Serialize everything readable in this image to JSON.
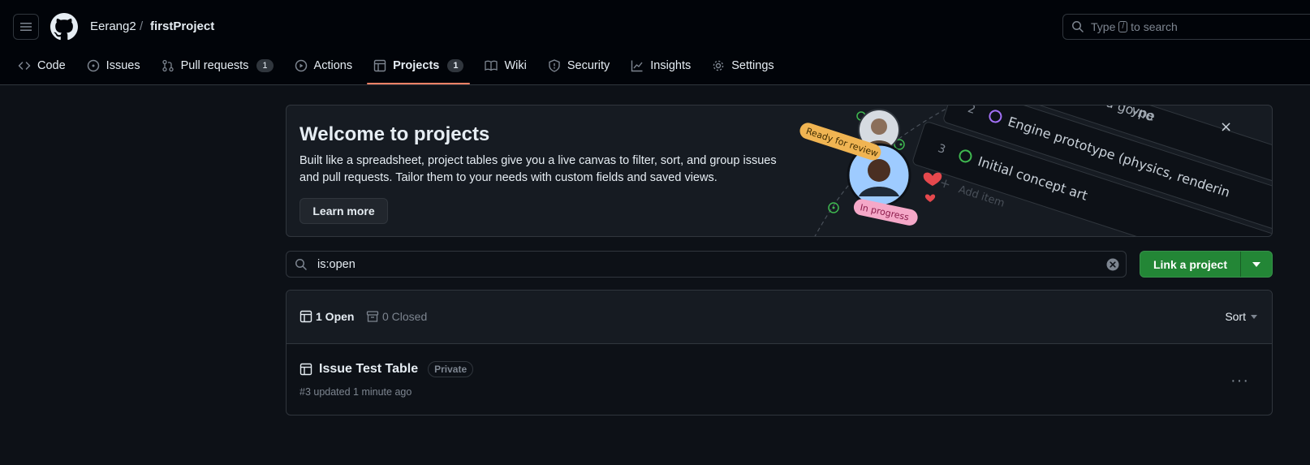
{
  "header": {
    "owner": "Eerang2",
    "separator": "/",
    "repo": "firstProject",
    "search": {
      "prefix": "Type",
      "key": "/",
      "suffix": "to search"
    }
  },
  "tabs": [
    {
      "label": "Code",
      "icon": "code-icon"
    },
    {
      "label": "Issues",
      "icon": "issue-icon"
    },
    {
      "label": "Pull requests",
      "icon": "pull-request-icon",
      "count": "1"
    },
    {
      "label": "Actions",
      "icon": "play-icon"
    },
    {
      "label": "Projects",
      "icon": "table-icon",
      "count": "1",
      "active": true
    },
    {
      "label": "Wiki",
      "icon": "book-icon"
    },
    {
      "label": "Security",
      "icon": "shield-icon"
    },
    {
      "label": "Insights",
      "icon": "graph-icon"
    },
    {
      "label": "Settings",
      "icon": "gear-icon"
    }
  ],
  "banner": {
    "title": "Welcome to projects",
    "description": "Built like a spreadsheet, project tables give you a live canvas to filter, sort, and group issues and pull requests. Tailor them to your needs with custom fields and saved views.",
    "learn_more": "Learn more",
    "art": {
      "ready_label": "Ready for review",
      "progress_label": "In progress",
      "row2_num": "2",
      "row2_text": "Engine prototype (physics, renderin",
      "row3_num": "3",
      "row3_text": "Initial concept art",
      "row1_text": "Game brief and go-no",
      "add_item": "Add item",
      "type_text": "ype"
    }
  },
  "filter": {
    "value": "is:open"
  },
  "link_project": {
    "label": "Link a project"
  },
  "list": {
    "open_label": "1 Open",
    "closed_label": "0 Closed",
    "sort_label": "Sort",
    "items": [
      {
        "title": "Issue Test Table",
        "visibility": "Private",
        "meta": "#3 updated 1 minute ago"
      }
    ]
  },
  "colors": {
    "accent": "#f78166",
    "primary_button": "#238636",
    "background": "#0d1117"
  }
}
